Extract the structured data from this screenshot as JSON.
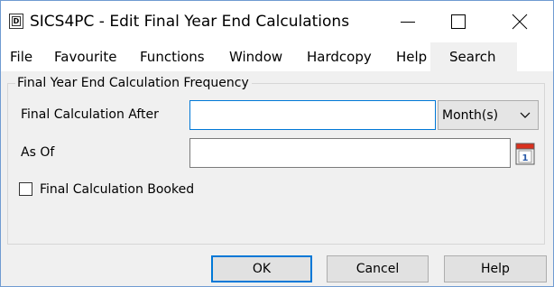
{
  "window": {
    "title": "SICS4PC - Edit Final Year End Calculations",
    "app_icon_letter": "D"
  },
  "menu": {
    "items": [
      "File",
      "Favourite",
      "Functions",
      "Window",
      "Hardcopy",
      "Help",
      "Search"
    ]
  },
  "group": {
    "legend": "Final Year End Calculation Frequency",
    "final_calc_after_label": "Final Calculation After",
    "final_calc_after_value": "",
    "unit_selected": "Month(s)",
    "as_of_label": "As Of",
    "as_of_value": "",
    "calendar_icon_text": "1",
    "booked_label": "Final Calculation Booked",
    "booked_checked": false
  },
  "buttons": {
    "ok": "OK",
    "cancel": "Cancel",
    "help": "Help"
  },
  "colors": {
    "accent": "#0078d7",
    "window_border": "#6f9bd1",
    "dialog_bg": "#f0f0f0",
    "calendar_red": "#d9301e"
  }
}
